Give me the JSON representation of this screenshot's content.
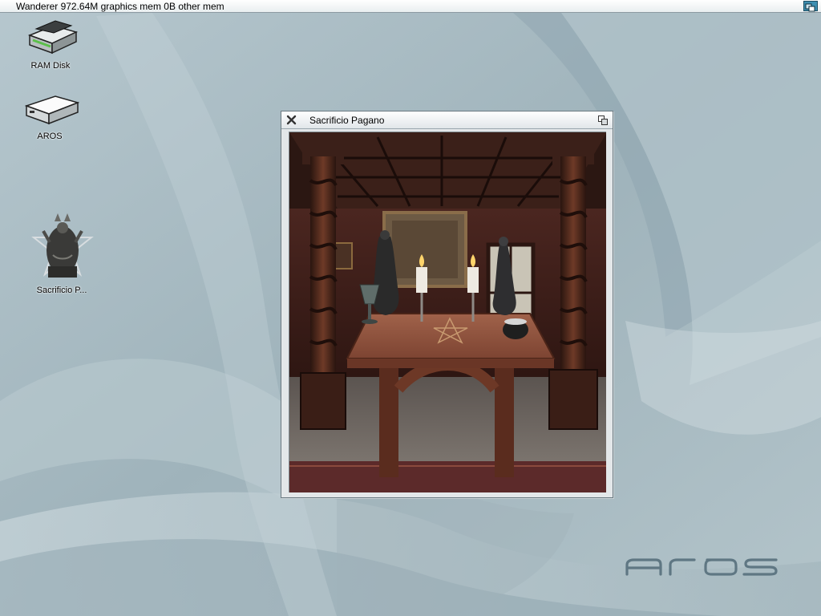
{
  "screen": {
    "title_text": "Wanderer 972.64M graphics mem 0B other mem",
    "depth_gadget_icon": "screen-depth-icon"
  },
  "desktop_icons": [
    {
      "label": "RAM Disk",
      "icon": "ram-disk-icon"
    },
    {
      "label": "AROS",
      "icon": "hard-drive-icon"
    },
    {
      "label": "Sacrificio P...",
      "icon": "sacrificio-image-icon"
    }
  ],
  "window": {
    "title": "Sacrificio Pagano",
    "close_icon": "close-icon",
    "depth_icon": "window-depth-icon",
    "content_description_icon": "pagan-altar-room-image"
  },
  "branding": {
    "logo_icon": "aros-logo"
  },
  "colors": {
    "desktop_background": "#a9bcc4",
    "menubar_background": "#ffffff",
    "gadget_accent": "#3e8fb1",
    "logo_color": "#5f7783"
  }
}
